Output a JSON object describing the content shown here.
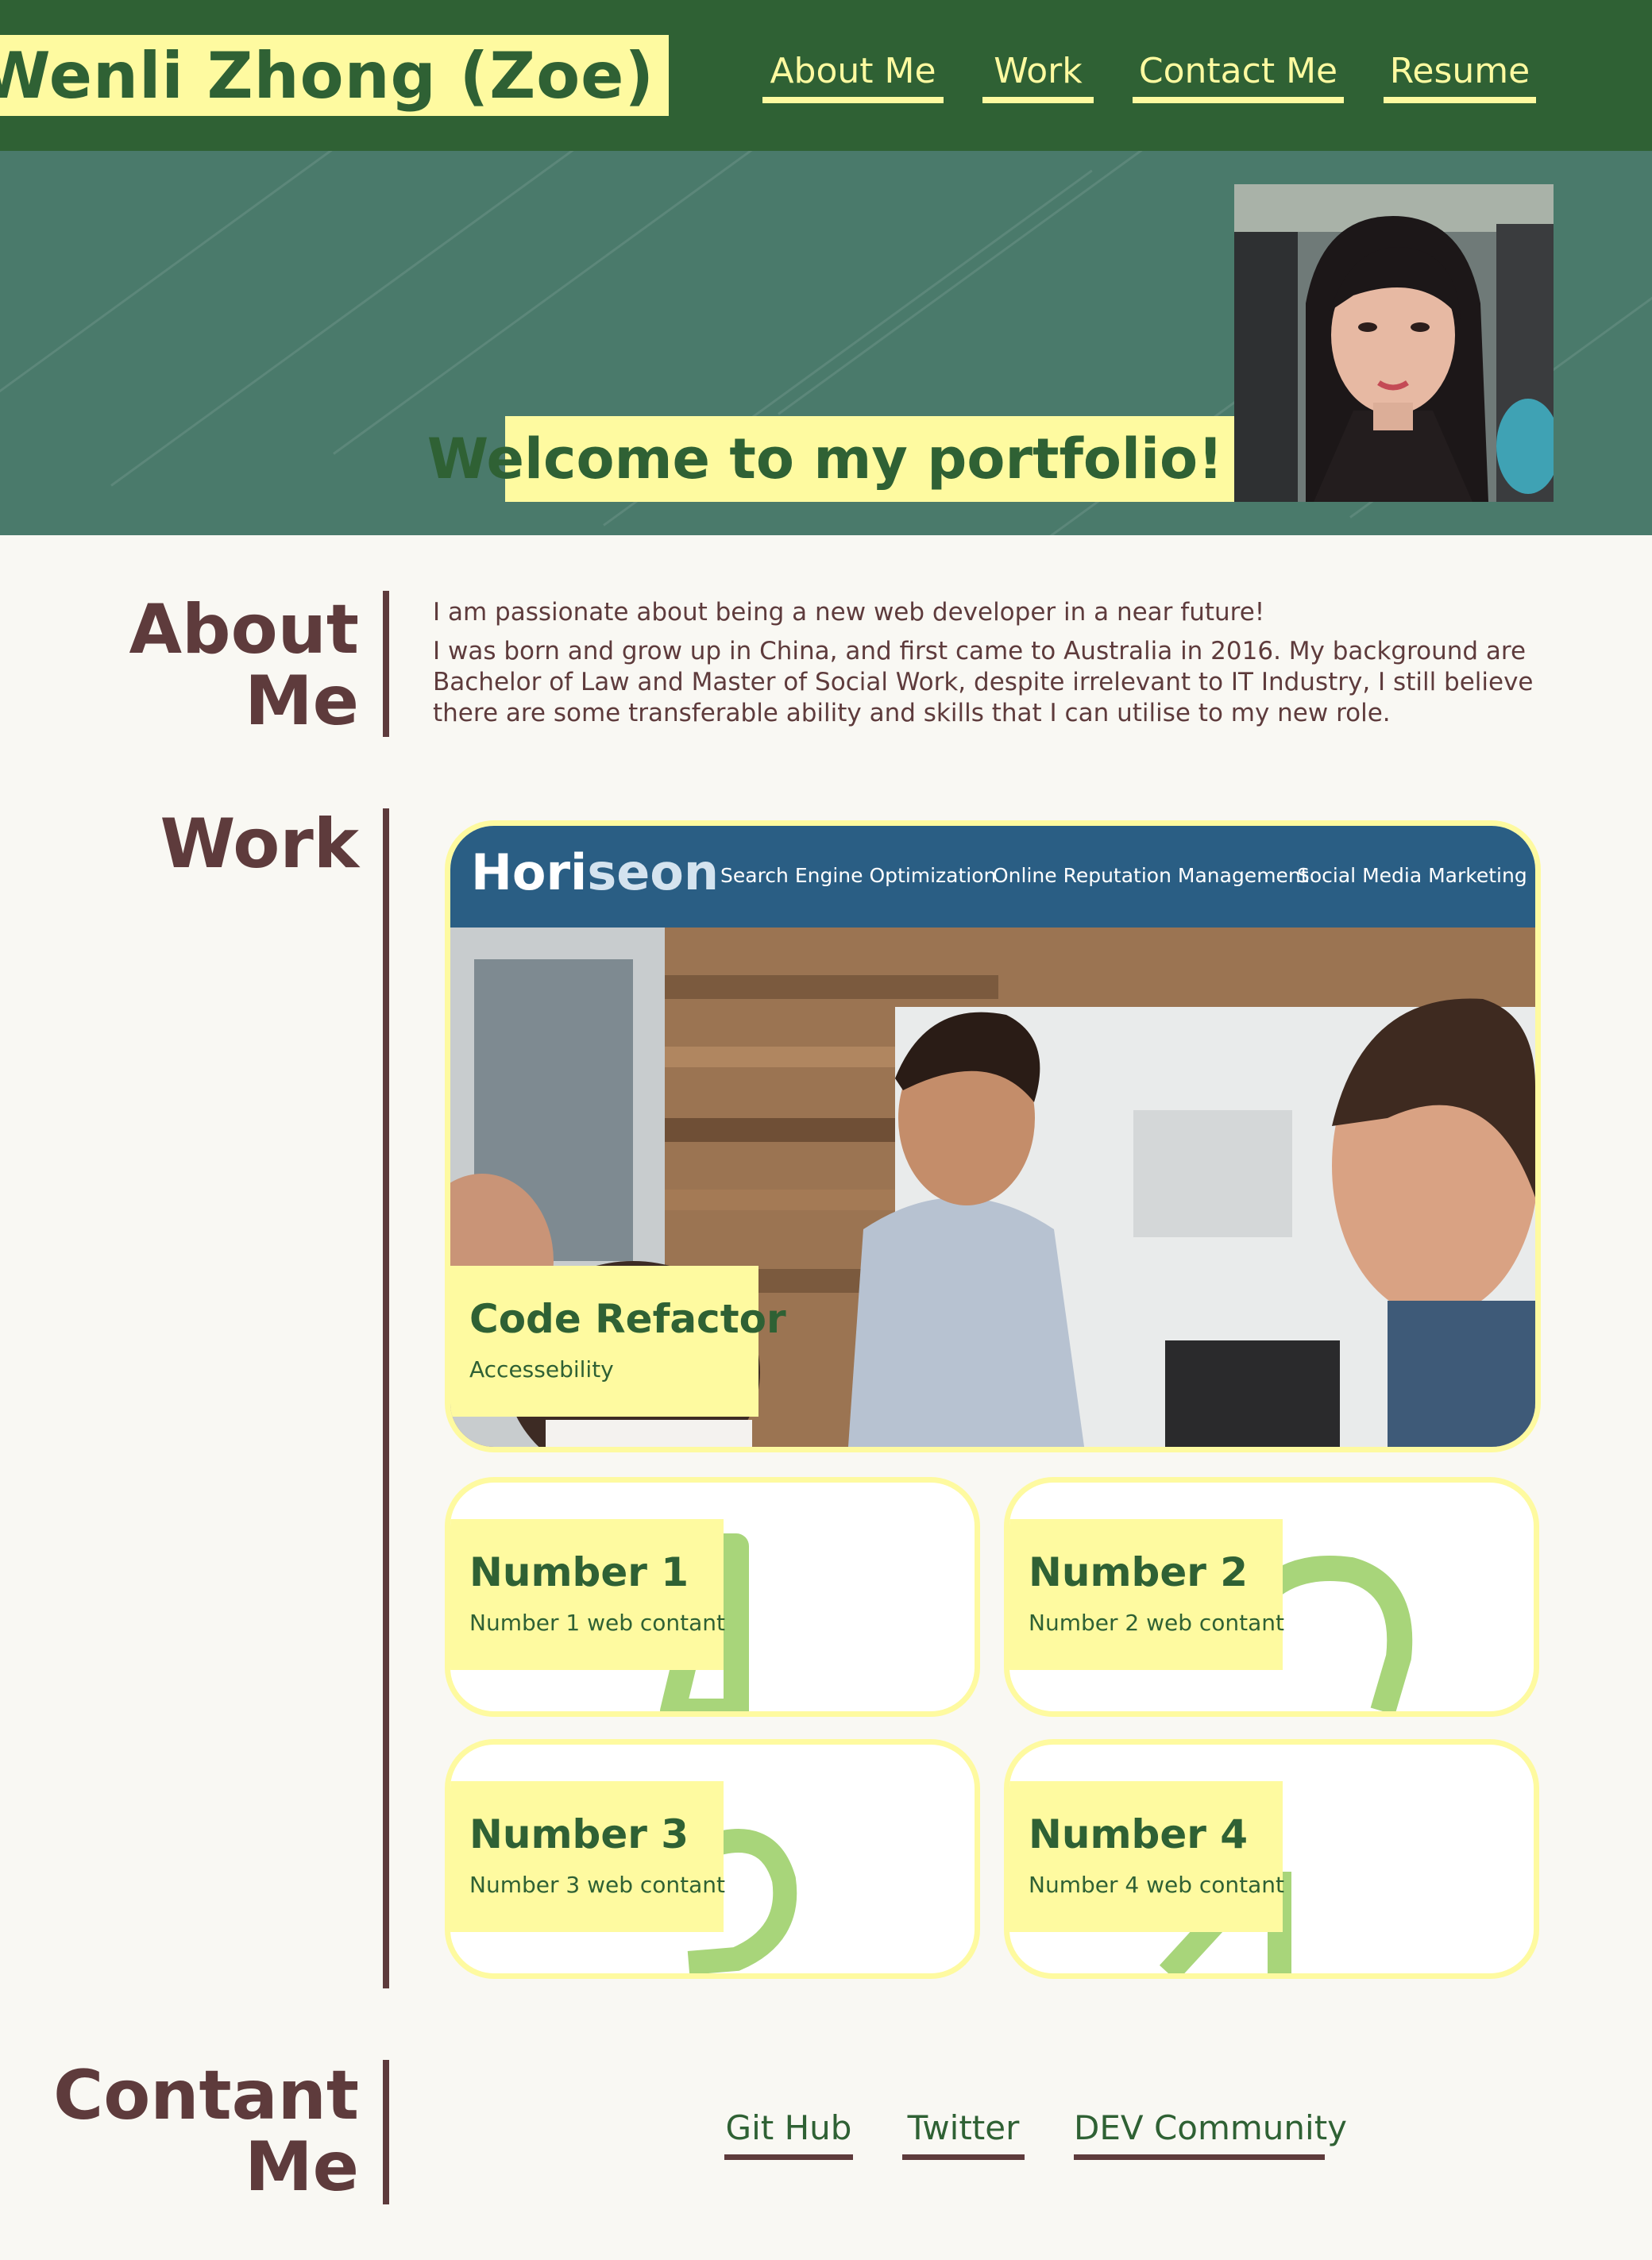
{
  "header": {
    "brand": "Wenli Zhong (Zoe)",
    "nav": [
      "About Me",
      "Work",
      "Contact Me",
      "Resume"
    ]
  },
  "hero": {
    "welcome": "Welcome to my portfolio!",
    "avatar_icon": "portrait-photo"
  },
  "about": {
    "title_line1": "About",
    "title_line2": "Me",
    "paragraphs": [
      "I am passionate about being a new web developer in a near future!",
      "I was born and grow up in China, and first came to Australia in 2016. My background are Bachelor of Law and Master of Social Work, despite irrelevant to IT Industry, I still believe there are some transferable ability and skills that I can utilise to my new role."
    ]
  },
  "work": {
    "title": "Work",
    "featured": {
      "logo_a": "Hori",
      "logo_b": "seon",
      "links": [
        "Search Engine Optimization",
        "Online Reputation Management",
        "Social Media Marketing"
      ],
      "title": "Code Refactor",
      "subtitle": "Accessebility"
    },
    "cards": [
      {
        "title": "Number 1",
        "subtitle": "Number 1 web contant"
      },
      {
        "title": "Number 2",
        "subtitle": "Number 2 web contant"
      },
      {
        "title": "Number 3",
        "subtitle": "Number 3 web contant"
      },
      {
        "title": "Number 4",
        "subtitle": "Number 4 web contant"
      }
    ]
  },
  "contact": {
    "title_line1": "Contant",
    "title_line2": "Me",
    "links": [
      "Git Hub",
      "Twitter",
      "DEV Community"
    ]
  },
  "colors": {
    "header_green": "#2f6134",
    "accent_yellow": "#fefaa0",
    "hero_teal": "#4a7a6b",
    "maroon": "#5e3b3c",
    "page_bg": "#f9f8f3",
    "horiseon_blue": "#2a5e84"
  }
}
